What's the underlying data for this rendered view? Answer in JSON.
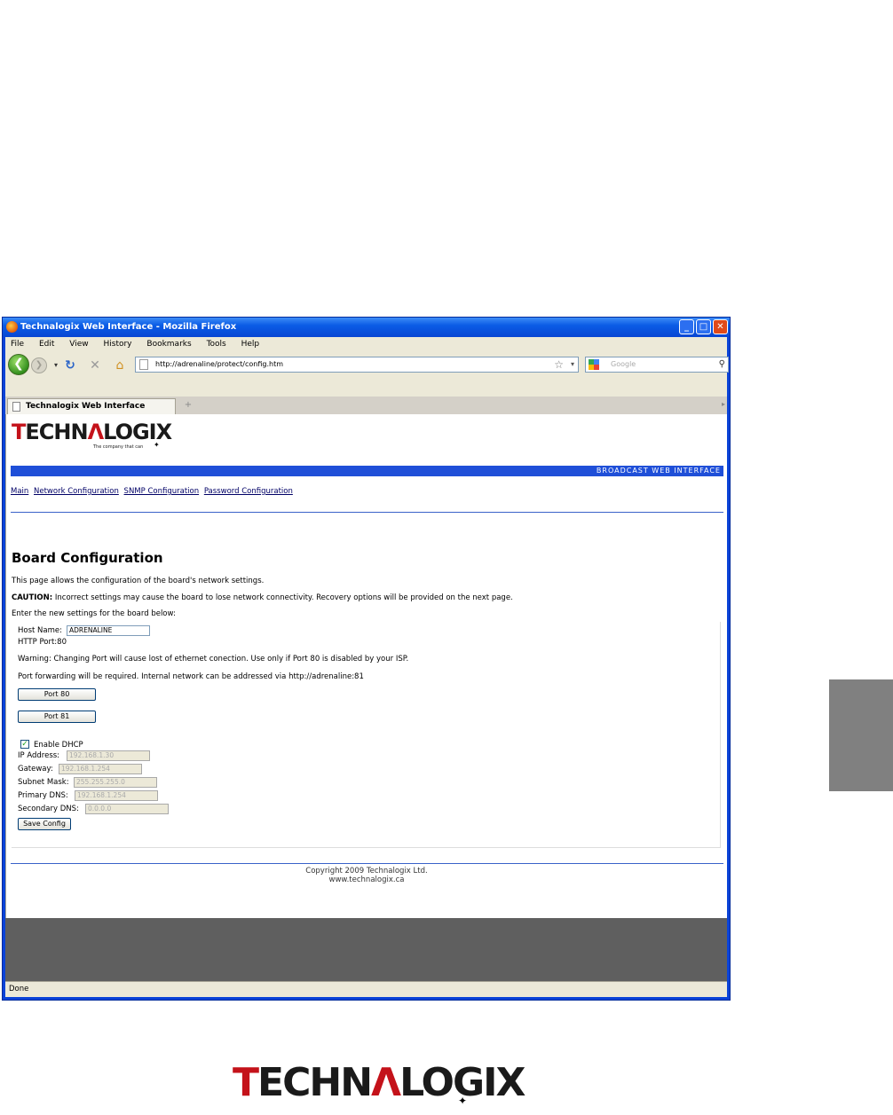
{
  "window": {
    "title": "Technalogix Web Interface - Mozilla Firefox",
    "controls": {
      "minimize": "_",
      "maximize": "□",
      "close": "✕"
    }
  },
  "menu": [
    "File",
    "Edit",
    "View",
    "History",
    "Bookmarks",
    "Tools",
    "Help"
  ],
  "toolbar": {
    "url": "http://adrenaline/protect/config.htm",
    "search_placeholder": "Google"
  },
  "tab": {
    "label": "Technalogix Web Interface",
    "new_tab": "+"
  },
  "logo": {
    "brand_a": "T",
    "brand_b": "ECHN",
    "brand_c": "Λ",
    "brand_d": "LOGIX",
    "tagline": "The company that can"
  },
  "banner": "BROADCAST WEB INTERFACE",
  "nav_links": [
    "Main",
    "Network Configuration",
    "SNMP Configuration",
    "Password Configuration"
  ],
  "page": {
    "title": "Board Configuration",
    "intro": "This page allows the configuration of the board's network settings.",
    "caution_label": "CAUTION:",
    "caution_text": " Incorrect settings may cause the board to lose network connectivity. Recovery options will be provided on the next page.",
    "enter_text": "Enter the new settings for the board below:"
  },
  "form": {
    "host_name_label": "Host Name:",
    "host_name_value": "ADRENALINE",
    "http_port_label": "HTTP Port:80",
    "warning": "Warning: Changing Port will cause lost of ethernet conection. Use only if Port 80 is disabled by your ISP.",
    "port_forward": "Port forwarding will be required. Internal network can be addressed via http://adrenaline:81",
    "port80_button": "Port 80",
    "port81_button": "Port 81",
    "dhcp_checked": true,
    "dhcp_label": "Enable DHCP",
    "ip_label": "IP Address:",
    "ip_value": "192.168.1.30",
    "gateway_label": "Gateway:",
    "gateway_value": "192.168.1.254",
    "subnet_label": "Subnet Mask:",
    "subnet_value": "255.255.255.0",
    "primary_dns_label": "Primary DNS:",
    "primary_dns_value": "192.168.1.254",
    "secondary_dns_label": "Secondary DNS:",
    "secondary_dns_value": "0.0.0.0",
    "save_button": "Save Config"
  },
  "footer": {
    "copyright": "Copyright 2009 Technalogix Ltd.",
    "site": "www.technalogix.ca"
  },
  "status": "Done"
}
